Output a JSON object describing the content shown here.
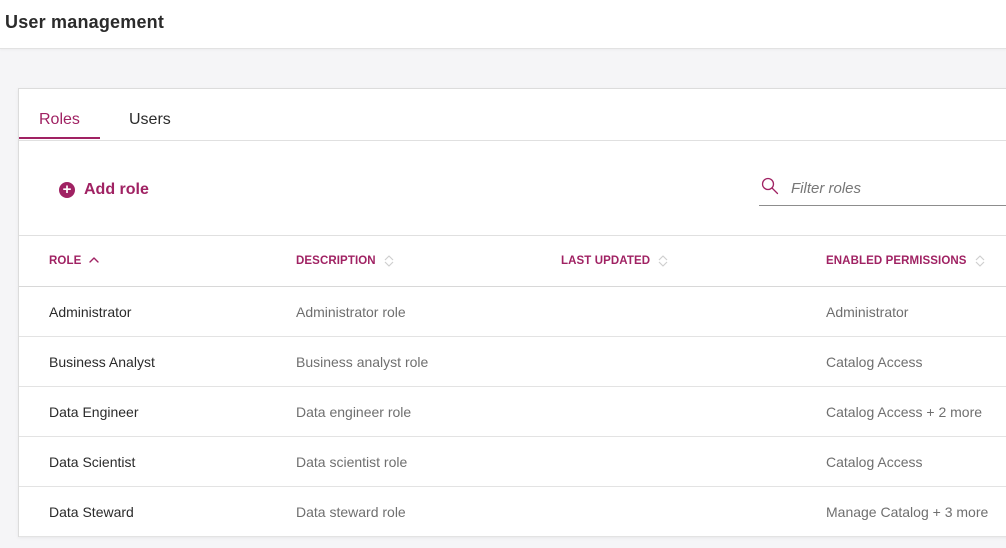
{
  "header": {
    "title": "User management"
  },
  "tabs": [
    {
      "label": "Roles",
      "active": true
    },
    {
      "label": "Users",
      "active": false
    }
  ],
  "toolbar": {
    "add_label": "Add role",
    "add_icon": "plus-circle-icon",
    "filter_placeholder": "Filter roles",
    "filter_value": "",
    "filter_icon": "search-icon"
  },
  "table": {
    "columns": [
      {
        "label": "ROLE",
        "sort": "ascending"
      },
      {
        "label": "DESCRIPTION",
        "sort": "none"
      },
      {
        "label": "LAST UPDATED",
        "sort": "none"
      },
      {
        "label": "ENABLED PERMISSIONS",
        "sort": "none"
      }
    ],
    "rows": [
      {
        "role": "Administrator",
        "description": "Administrator role",
        "last_updated": "",
        "permissions": "Administrator"
      },
      {
        "role": "Business Analyst",
        "description": "Business analyst role",
        "last_updated": "",
        "permissions": "Catalog Access"
      },
      {
        "role": "Data Engineer",
        "description": "Data engineer role",
        "last_updated": "",
        "permissions": "Catalog Access + 2 more"
      },
      {
        "role": "Data Scientist",
        "description": "Data scientist role",
        "last_updated": "",
        "permissions": "Catalog Access"
      },
      {
        "role": "Data Steward",
        "description": "Data steward role",
        "last_updated": "",
        "permissions": "Manage Catalog + 3 more"
      }
    ]
  },
  "colors": {
    "accent": "#a02263",
    "text": "#2b2b2b",
    "muted": "#6f6f6f",
    "background": "#f5f5f7"
  }
}
